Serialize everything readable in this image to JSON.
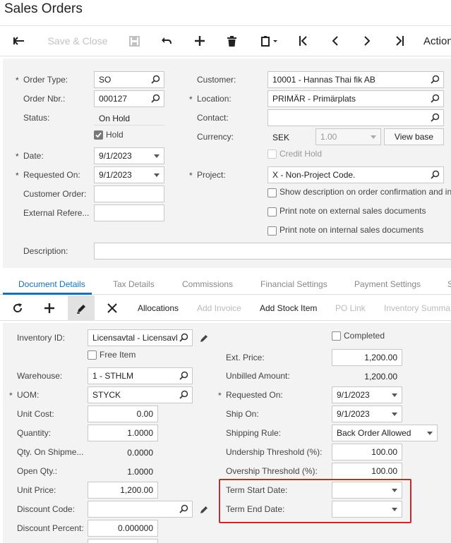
{
  "title": "Sales Orders",
  "toolbar": {
    "save_close": "Save & Close",
    "actions": "Action"
  },
  "header": {
    "order_type": {
      "label": "Order Type:",
      "value": "SO"
    },
    "order_nbr": {
      "label": "Order Nbr.:",
      "value": "000127"
    },
    "status": {
      "label": "Status:",
      "value": "On Hold"
    },
    "hold": {
      "label": "Hold",
      "checked": true
    },
    "date": {
      "label": "Date:",
      "value": "9/1/2023"
    },
    "requested_on": {
      "label": "Requested On:",
      "value": "9/1/2023"
    },
    "customer_order": {
      "label": "Customer Order:",
      "value": ""
    },
    "external_ref": {
      "label": "External Refere...",
      "value": ""
    },
    "description": {
      "label": "Description:",
      "value": ""
    },
    "customer": {
      "label": "Customer:",
      "value": "10001 - Hannas Thai fik AB"
    },
    "location": {
      "label": "Location:",
      "value": "PRIMÄR - Primärplats"
    },
    "contact": {
      "label": "Contact:",
      "value": ""
    },
    "currency": {
      "label": "Currency:",
      "value": "SEK",
      "rate": "1.00",
      "view_base": "View base"
    },
    "credit_hold": {
      "label": "Credit Hold",
      "checked": false
    },
    "project": {
      "label": "Project:",
      "value": "X - Non-Project Code."
    },
    "show_desc": {
      "label": "Show description on order confirmation and in",
      "checked": false
    },
    "print_ext": {
      "label": "Print note on external sales documents",
      "checked": false
    },
    "print_int": {
      "label": "Print note on internal sales documents",
      "checked": false
    }
  },
  "tabs": [
    "Document Details",
    "Tax Details",
    "Commissions",
    "Financial Settings",
    "Payment Settings",
    "S"
  ],
  "gridbar": {
    "allocations": "Allocations",
    "add_invoice": "Add Invoice",
    "add_stock_item": "Add Stock Item",
    "po_link": "PO Link",
    "inventory_summary": "Inventory Summa"
  },
  "detail": {
    "inventory_id": {
      "label": "Inventory ID:",
      "value": "Licensavtal - Licensavl"
    },
    "free_item": {
      "label": "Free Item",
      "checked": false
    },
    "warehouse": {
      "label": "Warehouse:",
      "value": "1 - STHLM"
    },
    "uom": {
      "label": "UOM:",
      "value": "STYCK"
    },
    "unit_cost": {
      "label": "Unit Cost:",
      "value": "0.00"
    },
    "quantity": {
      "label": "Quantity:",
      "value": "1.0000"
    },
    "qty_on_shipment": {
      "label": "Qty. On Shipme...",
      "value": "0.0000"
    },
    "open_qty": {
      "label": "Open Qty.:",
      "value": "1.0000"
    },
    "unit_price": {
      "label": "Unit Price:",
      "value": "1,200.00"
    },
    "discount_code": {
      "label": "Discount Code:",
      "value": ""
    },
    "discount_percent": {
      "label": "Discount Percent:",
      "value": "0.000000"
    },
    "completed": {
      "label": "Completed",
      "checked": false
    },
    "ext_price": {
      "label": "Ext. Price:",
      "value": "1,200.00"
    },
    "unbilled_amount": {
      "label": "Unbilled Amount:",
      "value": "1,200.00"
    },
    "requested_on": {
      "label": "Requested On:",
      "value": "9/1/2023"
    },
    "ship_on": {
      "label": "Ship On:",
      "value": "9/1/2023"
    },
    "shipping_rule": {
      "label": "Shipping Rule:",
      "value": "Back Order Allowed"
    },
    "undership": {
      "label": "Undership Threshold (%):",
      "value": "100.00"
    },
    "overship": {
      "label": "Overship Threshold (%):",
      "value": "100.00"
    },
    "term_start": {
      "label": "Term Start Date:",
      "value": ""
    },
    "term_end": {
      "label": "Term End Date:",
      "value": ""
    }
  },
  "colors": {
    "accent": "#1a6fb5",
    "highlight": "#c42c2c",
    "formbg": "#f3f3f3"
  }
}
